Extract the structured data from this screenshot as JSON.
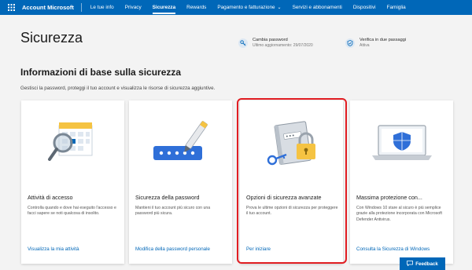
{
  "nav": {
    "brand": "Account Microsoft",
    "items": [
      {
        "label": "Le tue info",
        "active": false
      },
      {
        "label": "Privacy",
        "active": false
      },
      {
        "label": "Sicurezza",
        "active": true
      },
      {
        "label": "Rewards",
        "active": false
      },
      {
        "label": "Pagamento e fatturazione",
        "active": false,
        "dropdown": true
      },
      {
        "label": "Servizi e abbonamenti",
        "active": false
      },
      {
        "label": "Dispositivi",
        "active": false
      },
      {
        "label": "Famiglia",
        "active": false
      }
    ]
  },
  "header": {
    "title": "Sicurezza",
    "password": {
      "title": "Cambia password",
      "subtitle": "Ultimo aggiornamento: 29/07/2020",
      "icon": "key-icon"
    },
    "two_step": {
      "title": "Verifica in due passaggi",
      "subtitle": "Attiva",
      "icon": "shield-check-icon"
    }
  },
  "section": {
    "title": "Informazioni di base sulla sicurezza",
    "subtitle": "Gestisci la password, proteggi il tuo account e visualizza le risorse di sicurezza aggiuntive."
  },
  "cards": [
    {
      "title": "Attività di accesso",
      "description": "Controlla quando e dove hai eseguito l'accesso e facci sapere se noti qualcosa di insolito.",
      "link": "Visualizza la mia attività",
      "icon": "calendar-magnifier-icon"
    },
    {
      "title": "Sicurezza della password",
      "description": "Mantieni il tuo account più sicuro con una password più sicura.",
      "link": "Modifica della password personale",
      "icon": "password-pen-icon"
    },
    {
      "title": "Opzioni di sicurezza avanzate",
      "description": "Prova le ultime opzioni di sicurezza per proteggere il tuo account.",
      "link": "Per iniziare",
      "icon": "padlock-book-icon"
    },
    {
      "title": "Massima protezione con...",
      "description": "Con Windows 10 stare al sicuro è più semplice grazie alla protezione incorporata con Microsoft Defender Antivirus.",
      "link": "Consulta la Sicurezza di Windows",
      "icon": "laptop-shield-icon"
    }
  ],
  "feedback": {
    "label": "Feedback"
  },
  "colors": {
    "brand": "#0067b8",
    "highlight": "#e11d22",
    "background": "#f3f3f3"
  }
}
